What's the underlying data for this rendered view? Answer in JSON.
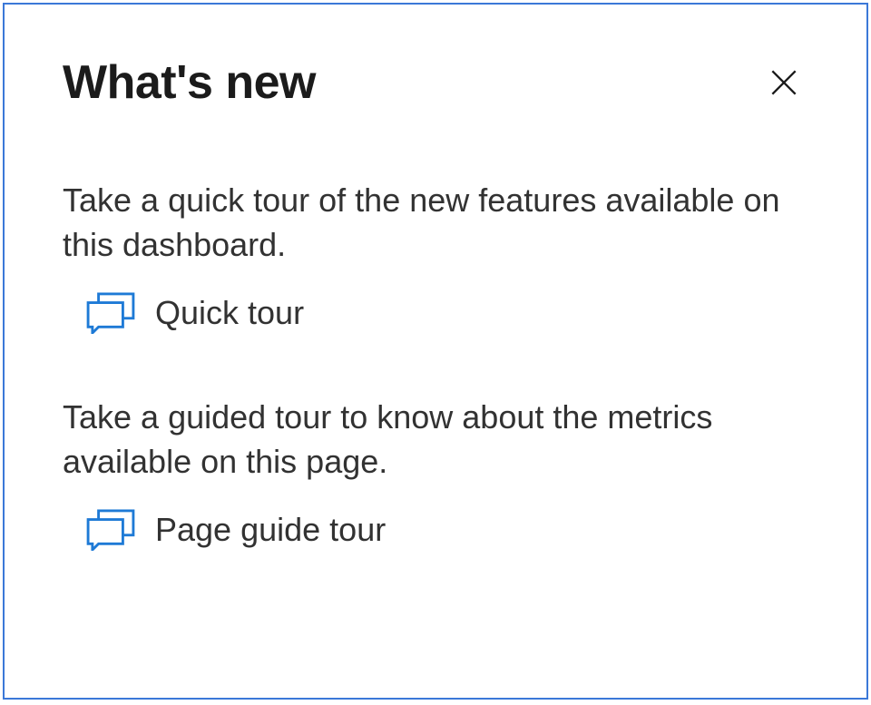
{
  "panel": {
    "title": "What's new",
    "sections": [
      {
        "description": "Take a quick tour of the new features available on this dashboard.",
        "link_label": "Quick tour"
      },
      {
        "description": "Take a guided tour to know about the metrics available on this page.",
        "link_label": "Page guide tour"
      }
    ]
  }
}
